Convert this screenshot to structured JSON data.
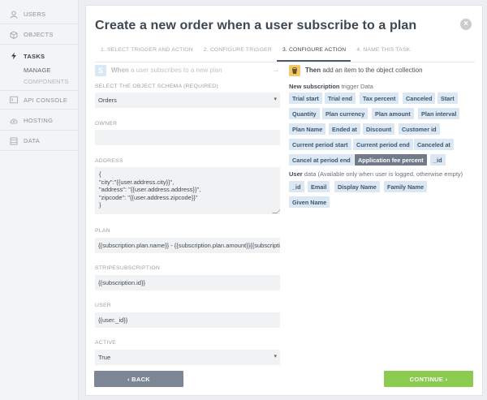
{
  "sidebar": {
    "items": [
      {
        "label": "USERS",
        "icon": "user-icon"
      },
      {
        "label": "OBJECTS",
        "icon": "cube-icon"
      },
      {
        "label": "TASKS",
        "icon": "lightning-icon"
      },
      {
        "label": "API CONSOLE",
        "icon": "terminal-icon"
      },
      {
        "label": "HOSTING",
        "icon": "cloud-upload-icon"
      },
      {
        "label": "DATA",
        "icon": "database-icon"
      }
    ],
    "sub": {
      "manage": "MANAGE",
      "components": "COMPONENTS"
    }
  },
  "modal": {
    "title": "Create a new order when a user subscribe to a plan",
    "close": "×",
    "steps": [
      "1. SELECT TRIGGER AND ACTION",
      "2. CONFIGURE TRIGGER",
      "3. CONFIGURE ACTION",
      "4. NAME THIS TASK"
    ]
  },
  "when": {
    "badge": "S",
    "bold": "When",
    "rest": " a user subscribes to a new plan",
    "arrow": "→"
  },
  "form": {
    "schema_label": "SELECT THE OBJECT SCHEMA (REQUIRED)",
    "schema_value": "Orders",
    "owner_label": "OWNER",
    "owner_value": "",
    "address_label": "ADDRESS",
    "address_value": "{\n\"city\":\"{{user.address.city}}\",\n\"address\": \"{{user.address.address}}\",\n\"zipcode\": \"{{user.address.zipcode}}\"\n}",
    "plan_label": "PLAN",
    "plan_value": "{{subscription.plan.name}} - {{subscription.plan.amount}}{{subscription.plan.currency}}",
    "stripe_label": "STRIPESUBSCRIPTION",
    "stripe_value": "{{subscription.id}}",
    "user_label": "USER",
    "user_value": "{{user._id}}",
    "active_label": "ACTIVE",
    "active_value": "True"
  },
  "then": {
    "bold": "Then",
    "rest": " add an item to the object collection"
  },
  "groups": {
    "subscription_bold": "New subscription",
    "subscription_rest": " trigger Data",
    "subscription_tags": [
      "Trial start",
      "Trial end",
      "Tax percent",
      "Canceled",
      "Start",
      "Quantity",
      "Plan currency",
      "Plan amount",
      "Plan interval",
      "Plan Name",
      "Ended at",
      "Discount",
      "Customer id",
      "Current period start",
      "Current period end",
      "Canceled at",
      "Cancel at period end",
      "Application fee percent",
      "_id"
    ],
    "user_bold": "User",
    "user_rest": " data (Available only when user is logged, otherwise empty)",
    "user_tags": [
      "_id",
      "Email",
      "Display Name",
      "Family Name",
      "Given Name"
    ]
  },
  "footer": {
    "back": "‹  BACK",
    "continue": "CONTINUE  ›"
  },
  "colors": {
    "accent_green": "#8bcb4f",
    "back_gray": "#7d8694",
    "tag_bg": "#dbe8f3",
    "tag_selected": "#707a89"
  }
}
